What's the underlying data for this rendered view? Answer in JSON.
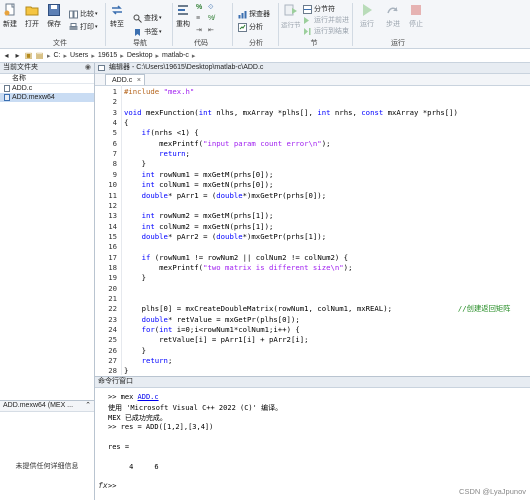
{
  "ribbon": {
    "file_group": {
      "label": "文件",
      "new": "新建",
      "open": "打开",
      "save": "保存",
      "compare": "比较",
      "print": "打印"
    },
    "nav_group": {
      "label": "导航",
      "goto": "转至",
      "find": "查找",
      "bookmark": "书签"
    },
    "code_group": {
      "label": "代码",
      "refactor": "重构"
    },
    "analyze_group": {
      "label": "分析",
      "profiler": "探查器",
      "analyze": "分析"
    },
    "section_group": {
      "label": "节",
      "run_section": "运行节",
      "section_break": "分节符",
      "run_and_advance": "运行并前进",
      "run_to_end": "运行到结束"
    },
    "run_group": {
      "label": "运行",
      "run": "运行",
      "step": "步进",
      "stop": "停止"
    }
  },
  "address": {
    "crumbs": [
      "C:",
      "Users",
      "19615",
      "Desktop",
      "matlab-c"
    ]
  },
  "left_panel": {
    "title": "当前文件夹",
    "col_header": "名称",
    "files": [
      {
        "name": "ADD.c",
        "selected": false
      },
      {
        "name": "ADD.mexw64",
        "selected": true
      }
    ],
    "detail_title": "ADD.mexw64  (MEX ...",
    "detail_msg": "未提供任何详细信息"
  },
  "editor": {
    "title": "编辑器 - C:\\Users\\19615\\Desktop\\matlab-c\\ADD.c",
    "tab": "ADD.c",
    "lines": [
      "#include \"mex.h\"",
      "",
      "void mexFunction(int nlhs, mxArray *plhs[], int nrhs, const mxArray *prhs[])",
      "{",
      "    if(nrhs <1) {",
      "        mexPrintf(\"input param count error\\n\");",
      "        return;",
      "    }",
      "    int rowNum1 = mxGetM(prhs[0]);",
      "    int colNum1 = mxGetN(prhs[0]);",
      "    double* pArr1 = (double*)mxGetPr(prhs[0]);",
      "",
      "    int rowNum2 = mxGetM(prhs[1]);",
      "    int colNum2 = mxGetN(prhs[1]);",
      "    double* pArr2 = (double*)mxGetPr(prhs[1]);",
      "",
      "    if (rowNum1 != rowNum2 || colNum2 != colNum2) {",
      "        mexPrintf(\"two matrix is different size\\n\");",
      "    }",
      "",
      "",
      "    plhs[0] = mxCreateDoubleMatrix(rowNum1, colNum1, mxREAL);               //创建返回矩阵",
      "    double* retValue = mxGetPr(plhs[0]);",
      "    for(int i=0;i<rowNum1*colNum1;i++) {",
      "        retValue[i] = pArr1[i] + pArr2[i];",
      "    }",
      "    return;",
      "}"
    ]
  },
  "command_window": {
    "title": "命令行窗口",
    "line1_prompt": ">> mex ",
    "line1_link": "ADD.c",
    "line2": "使用 'Microsoft Visual C++ 2022 (C)' 编译。",
    "line3": "MEX 已成功完成。",
    "line4": ">> res = ADD([1,2],[3,4])",
    "line5": "res =",
    "line6": "     4     6",
    "prompt": ">>",
    "fx": "fx"
  },
  "watermark": "CSDN @LyaJpunov"
}
